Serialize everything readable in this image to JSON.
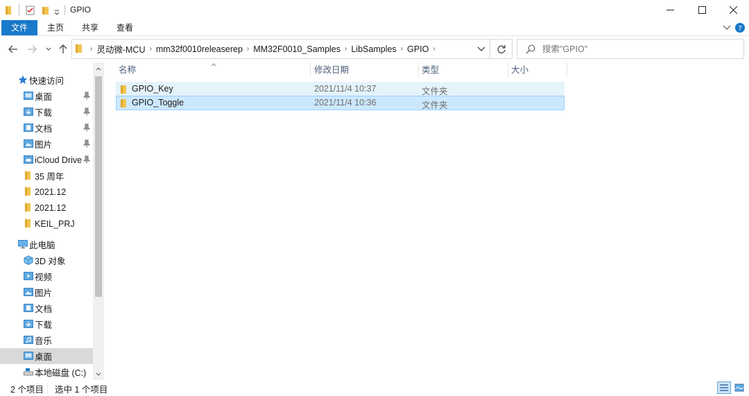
{
  "window": {
    "title": "GPIO",
    "minimize_icon": "minimize-icon",
    "maximize_icon": "maximize-icon",
    "close_icon": "close-icon"
  },
  "ribbon": {
    "file_tab": "文件",
    "tabs": [
      "主页",
      "共享",
      "查看"
    ]
  },
  "address": {
    "crumbs": [
      "灵动微-MCU",
      "mm32f0010releaserep",
      "MM32F0010_Samples",
      "LibSamples",
      "GPIO"
    ]
  },
  "search": {
    "placeholder": "搜索\"GPIO\""
  },
  "sidebar": {
    "quick_access": "快速访问",
    "quick_items": [
      {
        "label": "桌面",
        "pinned": true
      },
      {
        "label": "下载",
        "pinned": true
      },
      {
        "label": "文档",
        "pinned": true
      },
      {
        "label": "图片",
        "pinned": true
      },
      {
        "label": "iCloud Drive",
        "pinned": true
      },
      {
        "label": "35 周年",
        "pinned": false
      },
      {
        "label": "2021.12",
        "pinned": false
      },
      {
        "label": "2021.12",
        "pinned": false
      },
      {
        "label": "KEIL_PRJ",
        "pinned": false
      }
    ],
    "this_pc": "此电脑",
    "pc_items": [
      "3D 对象",
      "视频",
      "图片",
      "文档",
      "下载",
      "音乐",
      "桌面",
      "本地磁盘 (C:)"
    ],
    "selected": "桌面"
  },
  "columns": {
    "name": "名称",
    "modified": "修改日期",
    "type": "类型",
    "size": "大小"
  },
  "files": [
    {
      "name": "GPIO_Key",
      "modified": "2021/11/4 10:37",
      "type": "文件夹",
      "size": ""
    },
    {
      "name": "GPIO_Toggle",
      "modified": "2021/11/4 10:36",
      "type": "文件夹",
      "size": ""
    }
  ],
  "status": {
    "count": "2 个项目",
    "selected": "选中 1 个项目"
  },
  "colors": {
    "accent": "#1979ca",
    "selection": "#cce8ff",
    "hover": "#e5f3fb",
    "folder": "#f0c54f"
  }
}
